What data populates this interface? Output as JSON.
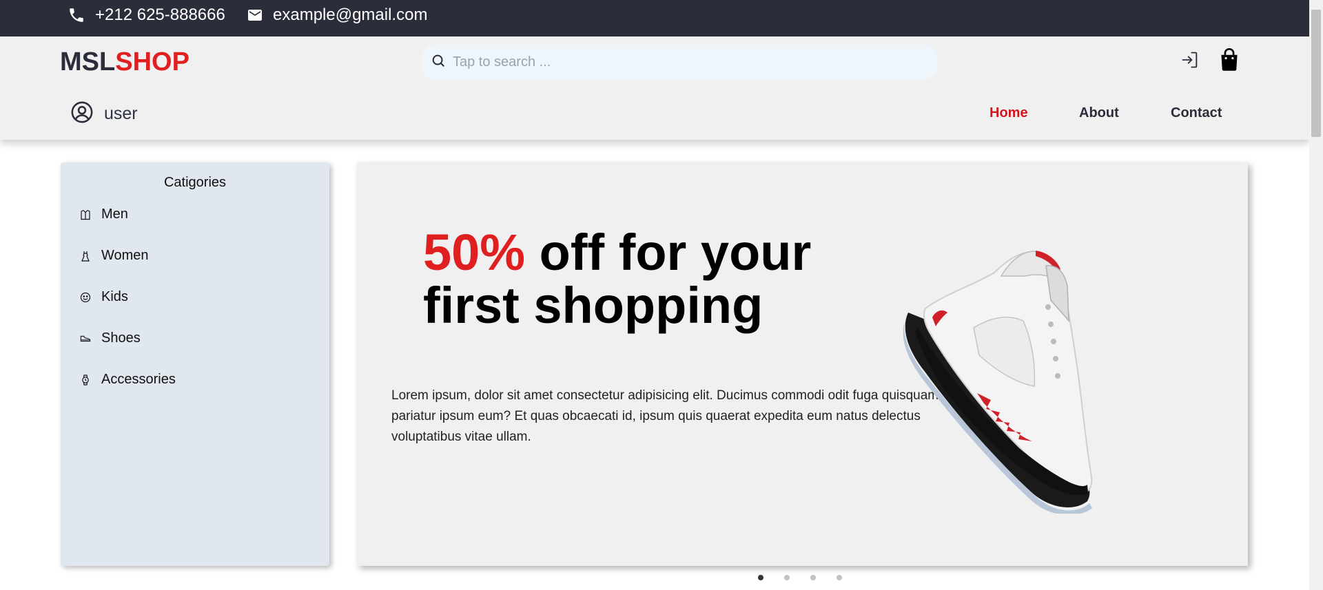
{
  "topbar": {
    "phone": "+212 625-888666",
    "email": "example@gmail.com"
  },
  "header": {
    "logo_part1": "MSL",
    "logo_part2": "SHOP",
    "search_placeholder": "Tap to search ...",
    "search_value": "",
    "user_label": "user"
  },
  "nav": {
    "items": [
      {
        "label": "Home",
        "active": true
      },
      {
        "label": "About",
        "active": false
      },
      {
        "label": "Contact",
        "active": false
      }
    ]
  },
  "sidebar": {
    "title": "Catigories",
    "items": [
      {
        "label": "Men",
        "icon": "shirt-icon"
      },
      {
        "label": "Women",
        "icon": "dress-icon"
      },
      {
        "label": "Kids",
        "icon": "smiley-icon"
      },
      {
        "label": "Shoes",
        "icon": "shoe-icon"
      },
      {
        "label": "Accessories",
        "icon": "watch-icon"
      }
    ]
  },
  "hero": {
    "highlight": "50%",
    "headline_rest": " off for your first shopping",
    "description": "Lorem ipsum, dolor sit amet consectetur adipisicing elit. Ducimus commodi odit fuga quisquam pariatur ipsum eum? Et quas obcaecati id, ipsum quis quaerat expedita eum natus delectus voluptatibus vitae ullam.",
    "image": "sneaker-image"
  },
  "carousel": {
    "slides": 4,
    "active_index": 0
  },
  "colors": {
    "topbar_bg": "#2b2d3a",
    "accent": "#e02020",
    "sidebar_bg": "#e1e7ef",
    "hero_bg": "#f0f0f0"
  }
}
